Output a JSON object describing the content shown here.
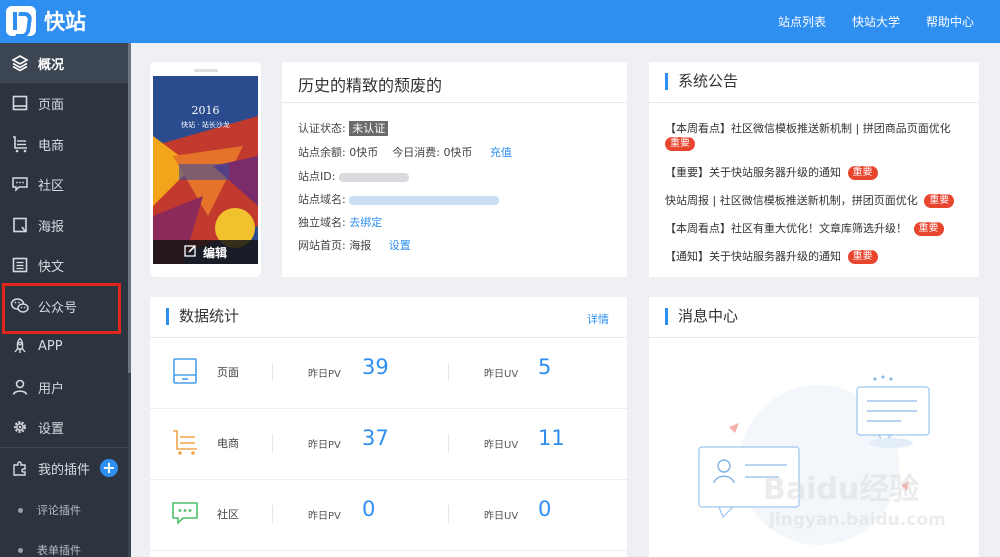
{
  "app": {
    "logo_text": "快站"
  },
  "topnav": {
    "items": [
      "站点列表",
      "快站大学",
      "帮助中心"
    ]
  },
  "sidebar": {
    "items": [
      {
        "label": "概况",
        "icon": "layers-icon",
        "active": true
      },
      {
        "label": "页面",
        "icon": "page-icon"
      },
      {
        "label": "电商",
        "icon": "cart-icon"
      },
      {
        "label": "社区",
        "icon": "chat-icon"
      },
      {
        "label": "海报",
        "icon": "poster-icon"
      },
      {
        "label": "快文",
        "icon": "article-icon"
      },
      {
        "label": "公众号",
        "icon": "wechat-icon"
      },
      {
        "label": "APP",
        "icon": "rocket-icon"
      },
      {
        "label": "用户",
        "icon": "user-icon"
      },
      {
        "label": "设置",
        "icon": "gear-icon"
      },
      {
        "label": "我的插件",
        "icon": "plugin-icon"
      }
    ],
    "plus": "+",
    "plugins": [
      {
        "label": "评论插件"
      },
      {
        "label": "表单插件"
      }
    ]
  },
  "phone": {
    "edit_label": "编辑",
    "poster_year": "2016",
    "poster_sub": "快站 · 站长沙龙"
  },
  "site": {
    "title": "历史的精致的颓废的",
    "auth_label": "认证状态:",
    "auth_value": "未认证",
    "balance_label": "站点余额:",
    "balance_value": "0快币",
    "today_label": "今日消费:",
    "today_value": "0快币",
    "recharge": "充值",
    "id_label": "站点ID:",
    "domain_label": "站点域名:",
    "custom_domain_label": "独立域名:",
    "custom_domain_link": "去绑定",
    "homepage_label": "网站首页:",
    "homepage_value": "海报",
    "homepage_link": "设置"
  },
  "notice": {
    "title": "系统公告",
    "items": [
      {
        "text": "【本周看点】社区微信模板推送新机制 | 拼团商品页面优化",
        "tag": "重要"
      },
      {
        "text": "【重要】关于快站服务器升级的通知",
        "tag": "重要"
      },
      {
        "text": "快站周报 | 社区微信模板推送新机制，拼团页面优化",
        "tag": "重要"
      },
      {
        "text": "【本周看点】社区有重大优化！文章库筛选升级！",
        "tag": "重要"
      },
      {
        "text": "【通知】关于快站服务器升级的通知",
        "tag": "重要"
      }
    ]
  },
  "stats": {
    "title": "数据统计",
    "more": "详情",
    "pv_label": "昨日PV",
    "uv_label": "昨日UV",
    "rows": [
      {
        "name": "页面",
        "pv": "39",
        "uv": "5",
        "color": "#4a9ee8"
      },
      {
        "name": "电商",
        "pv": "37",
        "uv": "11",
        "color": "#f0a44a"
      },
      {
        "name": "社区",
        "pv": "0",
        "uv": "0",
        "color": "#4cbf6e"
      }
    ]
  },
  "messages": {
    "title": "消息中心"
  },
  "watermark": {
    "line1": "Baidu经验",
    "line2": "jingyan.baidu.com"
  },
  "colors": {
    "accent": "#2f8ff0",
    "sidebar": "#2c3440",
    "tag": "#e8452f"
  }
}
